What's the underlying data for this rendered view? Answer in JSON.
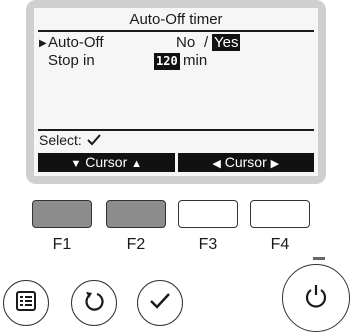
{
  "screen": {
    "title": "Auto-Off timer",
    "auto_off": {
      "label": "Auto-Off",
      "option_no": "No",
      "separator": "/",
      "option_yes": "Yes",
      "selected": "Yes"
    },
    "stop_in": {
      "label": "Stop in",
      "value": "120",
      "unit": "min"
    },
    "select_label": "Select:",
    "softkeys": [
      {
        "text": "Cursor",
        "left_icon": "down-triangle-icon",
        "right_icon": "up-triangle-icon"
      },
      {
        "text": "Cursor",
        "left_icon": "left-triangle-icon",
        "right_icon": "right-triangle-icon"
      }
    ]
  },
  "function_keys": [
    "F1",
    "F2",
    "F3",
    "F4"
  ],
  "buttons": {
    "menu": "menu-icon",
    "return": "return-icon",
    "select": "check-icon",
    "power": "power-icon"
  },
  "colors": {
    "screen_bg": "#f6f6f6",
    "bezel": "#cfcfcf",
    "highlight": "#111111",
    "fkey_active": "#8c8c8c"
  }
}
